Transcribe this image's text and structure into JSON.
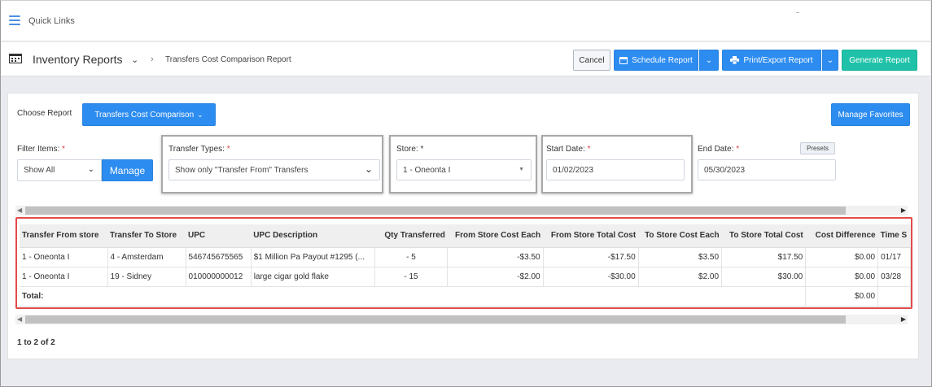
{
  "topbar": {
    "quick_links": "Quick Links"
  },
  "header": {
    "module": "Inventory Reports",
    "breadcrumb": "Transfers Cost Comparison Report",
    "cancel": "Cancel",
    "schedule": "Schedule Report",
    "print_export": "Print/Export Report",
    "generate": "Generate Report"
  },
  "report": {
    "choose_label": "Choose Report",
    "choose_value": "Transfers Cost Comparison",
    "manage_favorites": "Manage Favorites"
  },
  "filters": {
    "filter_items_label": "Filter Items:",
    "filter_items_value": "Show All",
    "manage": "Manage",
    "transfer_types_label": "Transfer Types:",
    "transfer_types_value": "Show only \"Transfer From\" Transfers",
    "store_label": "Store:",
    "store_value": "1 - Oneonta I",
    "start_date_label": "Start Date:",
    "start_date_value": "01/02/2023",
    "end_date_label": "End Date:",
    "end_date_value": "05/30/2023",
    "presets": "Presets",
    "required_mark": "*"
  },
  "table": {
    "columns": [
      "Transfer From store",
      "Transfer To Store",
      "UPC",
      "UPC Description",
      "Qty Transferred",
      "From Store Cost Each",
      "From Store Total Cost",
      "To Store Cost Each",
      "To Store Total Cost",
      "Cost Difference",
      "Time S"
    ],
    "rows": [
      [
        "1 - Oneonta I",
        "4 - Amsterdam",
        "546745675565",
        "$1 Million Pa Payout #1295 (...",
        "- 5",
        "-$3.50",
        "-$17.50",
        "$3.50",
        "$17.50",
        "$0.00",
        "01/17"
      ],
      [
        "1 - Oneonta I",
        "19 - Sidney",
        "010000000012",
        "large cigar gold flake",
        "- 15",
        "-$2.00",
        "-$30.00",
        "$2.00",
        "$30.00",
        "$0.00",
        "03/28"
      ]
    ],
    "total_label": "Total:",
    "total_value": "$0.00"
  },
  "pager": "1 to 2 of 2",
  "colors": {
    "primary": "#2d8cf0",
    "generate": "#1fc2a8",
    "highlight": "#e24b4b"
  }
}
